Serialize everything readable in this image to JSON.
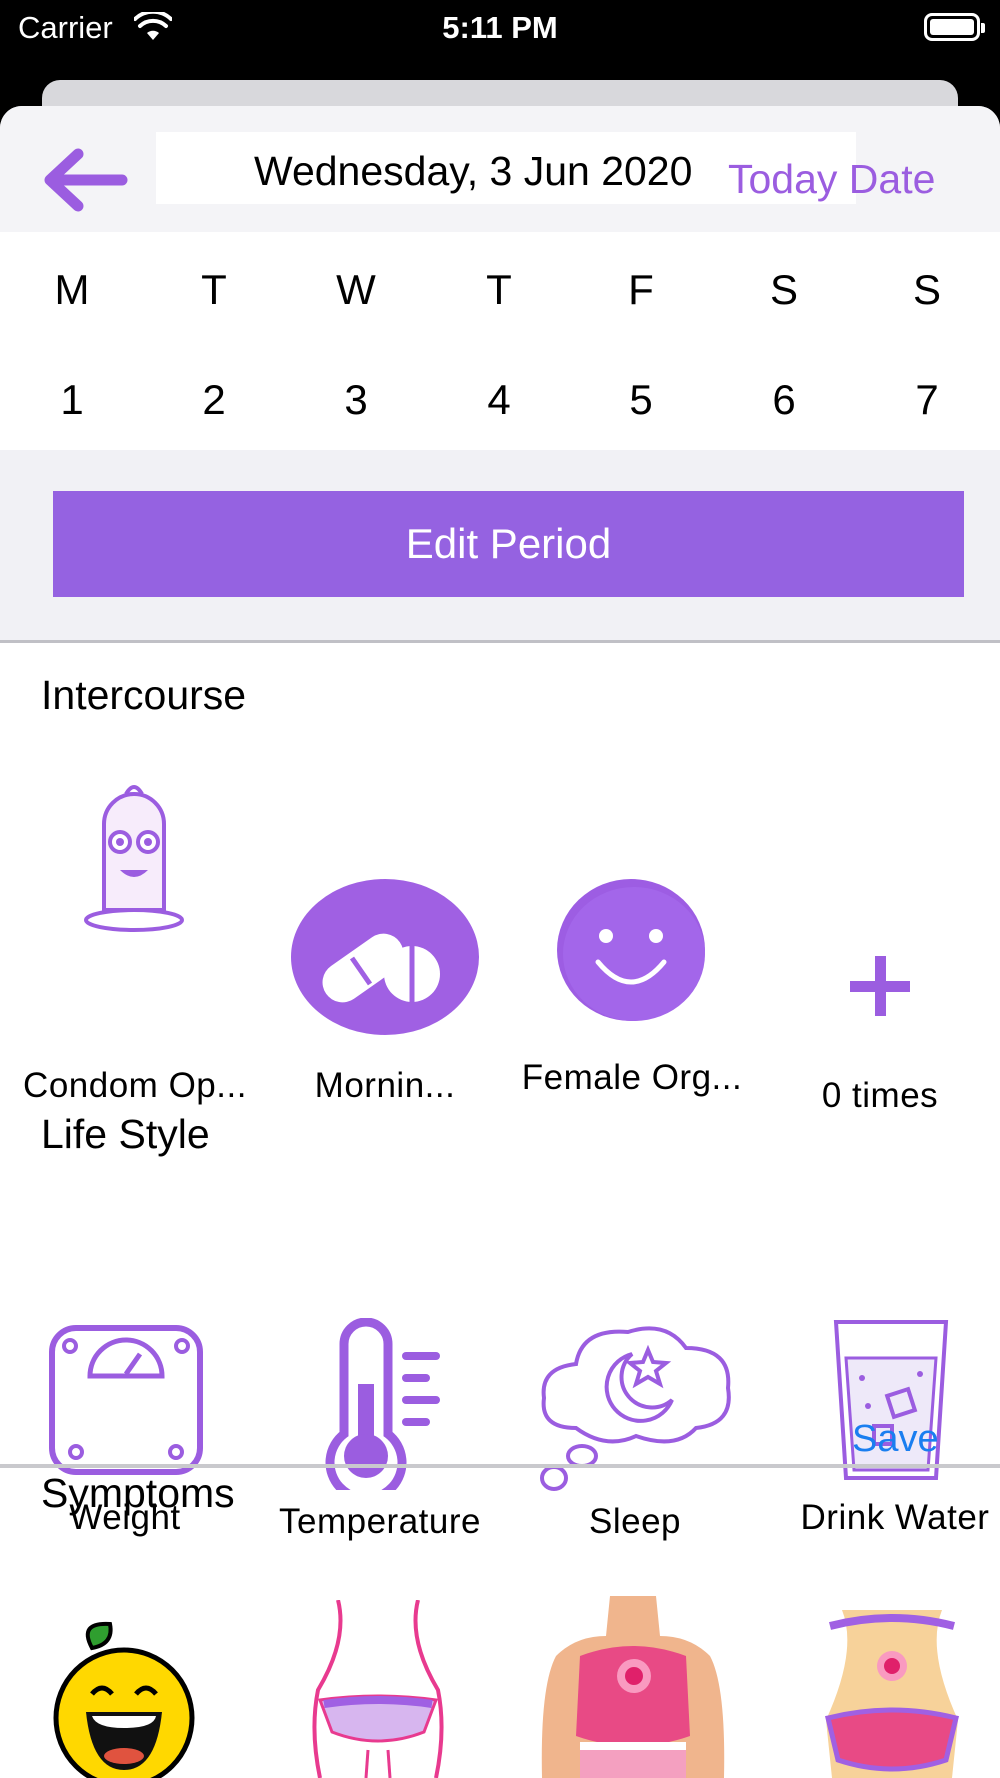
{
  "status_bar": {
    "carrier": "Carrier",
    "time": "5:11 PM"
  },
  "header": {
    "date": "Wednesday, 3 Jun 2020",
    "today_button": "Today Date"
  },
  "week": {
    "days": [
      "M",
      "T",
      "W",
      "T",
      "F",
      "S",
      "S"
    ],
    "dates": [
      "1",
      "2",
      "3",
      "4",
      "5",
      "6",
      "7"
    ]
  },
  "edit_period": {
    "label": "Edit Period"
  },
  "intercourse": {
    "title": "Intercourse",
    "items": [
      {
        "label": "Condom Op...",
        "icon": "condom-icon"
      },
      {
        "label": "Mornin...",
        "icon": "pill-icon"
      },
      {
        "label": "Female Org...",
        "icon": "smiley-icon"
      },
      {
        "label": "0 times",
        "icon": "plus-icon"
      }
    ]
  },
  "lifestyle": {
    "title": "Life Style",
    "items": [
      {
        "label": "Weight",
        "icon": "scale-icon"
      },
      {
        "label": "Temperature",
        "icon": "thermometer-icon"
      },
      {
        "label": "Sleep",
        "icon": "sleep-icon"
      },
      {
        "label": "Drink Water",
        "icon": "water-glass-icon"
      }
    ]
  },
  "symptoms": {
    "title": "Symptoms",
    "save_label": "Save",
    "items": [
      {
        "icon": "happy-lemon-icon"
      },
      {
        "icon": "body-waist-icon"
      },
      {
        "icon": "chest-pain-icon"
      },
      {
        "icon": "pelvic-pain-icon"
      }
    ]
  },
  "colors": {
    "accent": "#9562e1",
    "link": "#1a7ef0"
  }
}
